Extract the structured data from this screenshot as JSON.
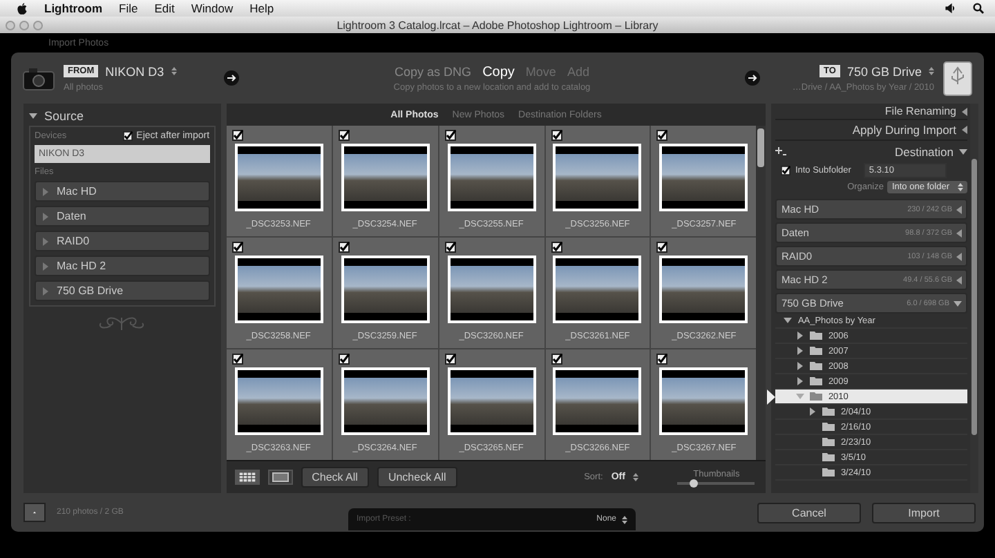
{
  "menubar": {
    "app": "Lightroom",
    "items": [
      "File",
      "Edit",
      "Window",
      "Help"
    ]
  },
  "window": {
    "title": "Lightroom 3 Catalog.lrcat – Adobe Photoshop Lightroom – Library"
  },
  "module_label": "Import Photos",
  "from": {
    "badge": "FROM",
    "device": "NIKON D3",
    "subtitle": "All photos"
  },
  "modes": [
    {
      "label": "Copy as DNG",
      "selected": false,
      "disabled": false
    },
    {
      "label": "Copy",
      "selected": true,
      "disabled": false
    },
    {
      "label": "Move",
      "selected": false,
      "disabled": true
    },
    {
      "label": "Add",
      "selected": false,
      "disabled": true
    }
  ],
  "mode_description": "Copy photos to a new location and add to catalog",
  "to": {
    "badge": "TO",
    "drive": "750 GB Drive",
    "path": "…Drive / AA_Photos by Year / 2010"
  },
  "source": {
    "title": "Source",
    "expanded": true,
    "devices_label": "Devices",
    "eject": {
      "label": "Eject after import",
      "checked": true
    },
    "devices": [
      {
        "name": "NIKON D3",
        "selected": true
      }
    ],
    "files_label": "Files",
    "volumes": [
      {
        "name": "Mac HD",
        "expanded": false
      },
      {
        "name": "Daten",
        "expanded": false
      },
      {
        "name": "RAID0",
        "expanded": false
      },
      {
        "name": "Mac HD 2",
        "expanded": false
      },
      {
        "name": "750 GB Drive",
        "expanded": false
      }
    ]
  },
  "grid_tabs": [
    {
      "label": "All Photos",
      "selected": true
    },
    {
      "label": "New Photos",
      "selected": false
    },
    {
      "label": "Destination Folders",
      "selected": false
    }
  ],
  "photos": [
    {
      "name": "_DSC3253.NEF",
      "checked": true
    },
    {
      "name": "_DSC3254.NEF",
      "checked": true
    },
    {
      "name": "_DSC3255.NEF",
      "checked": true
    },
    {
      "name": "_DSC3256.NEF",
      "checked": true
    },
    {
      "name": "_DSC3257.NEF",
      "checked": true
    },
    {
      "name": "_DSC3258.NEF",
      "checked": true
    },
    {
      "name": "_DSC3259.NEF",
      "checked": true
    },
    {
      "name": "_DSC3260.NEF",
      "checked": true
    },
    {
      "name": "_DSC3261.NEF",
      "checked": true
    },
    {
      "name": "_DSC3262.NEF",
      "checked": true
    },
    {
      "name": "_DSC3263.NEF",
      "checked": true
    },
    {
      "name": "_DSC3264.NEF",
      "checked": true
    },
    {
      "name": "_DSC3265.NEF",
      "checked": true
    },
    {
      "name": "_DSC3266.NEF",
      "checked": true
    },
    {
      "name": "_DSC3267.NEF",
      "checked": true
    }
  ],
  "toolbar": {
    "views": [
      {
        "kind": "grid",
        "selected": true
      },
      {
        "kind": "loupe",
        "selected": false
      }
    ],
    "buttons": [
      "Check All",
      "Uncheck All"
    ],
    "sort_label": "Sort:",
    "sort_value": "Off",
    "thumbnails_label": "Thumbnails",
    "thumbnail_size": {
      "level": 0.2
    }
  },
  "right_sections": [
    {
      "title": "File Renaming",
      "expanded": false
    },
    {
      "title": "Apply During Import",
      "expanded": false
    }
  ],
  "destination": {
    "title": "Destination",
    "expanded": true,
    "subfolder": {
      "label": "Into Subfolder",
      "checked": true,
      "value": "5.3.10"
    },
    "organize_label": "Organize",
    "organize_value": "Into one folder",
    "volumes": [
      {
        "name": "Mac HD",
        "capacity": "230 / 242 GB",
        "expanded": false
      },
      {
        "name": "Daten",
        "capacity": "98.8 / 372 GB",
        "expanded": false
      },
      {
        "name": "RAID0",
        "capacity": "103 / 148 GB",
        "expanded": false
      },
      {
        "name": "Mac HD 2",
        "capacity": "49.4 / 55.6 GB",
        "expanded": false
      },
      {
        "name": "750 GB Drive",
        "capacity": "6.0 / 698 GB",
        "expanded": true,
        "children": [
          {
            "name": "AA_Photos by Year",
            "expanded": true,
            "selected": false,
            "children": [
              {
                "name": "2006",
                "expanded": false,
                "selected": false
              },
              {
                "name": "2007",
                "expanded": false,
                "selected": false
              },
              {
                "name": "2008",
                "expanded": false,
                "selected": false
              },
              {
                "name": "2009",
                "expanded": false,
                "selected": false
              },
              {
                "name": "2010",
                "expanded": true,
                "selected": true,
                "children": [
                  {
                    "name": "2/04/10",
                    "expanded": false,
                    "selected": false
                  },
                  {
                    "name": "2/16/10",
                    "selected": false
                  },
                  {
                    "name": "2/23/10",
                    "selected": false
                  },
                  {
                    "name": "3/5/10",
                    "selected": false
                  },
                  {
                    "name": "3/24/10",
                    "selected": false
                  }
                ]
              }
            ]
          }
        ]
      }
    ]
  },
  "status": {
    "summary": "210 photos / 2 GB"
  },
  "preset": {
    "label": "Import Preset :",
    "value": "None"
  },
  "actions": [
    "Cancel",
    "Import"
  ]
}
